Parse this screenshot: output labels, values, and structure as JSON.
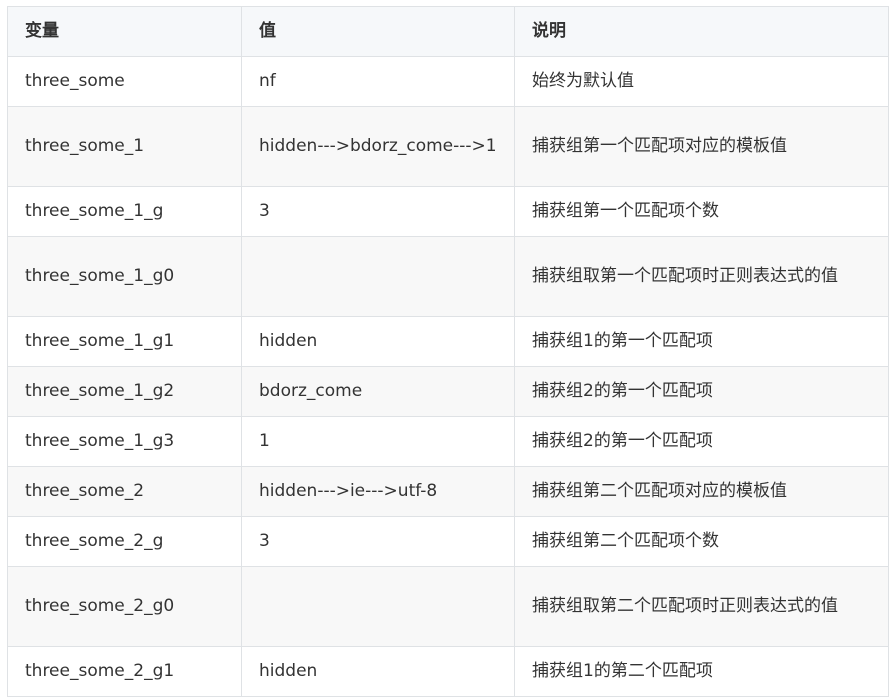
{
  "table": {
    "headers": [
      "变量",
      "值",
      "说明"
    ],
    "rows": [
      {
        "var": "three_some",
        "value": "nf",
        "desc": "始终为默认值"
      },
      {
        "var": "three_some_1",
        "value": "hidden--->bdorz_come--->1",
        "desc": "捕获组第一个匹配项对应的模板值"
      },
      {
        "var": "three_some_1_g",
        "value": "3",
        "desc": "捕获组第一个匹配项个数"
      },
      {
        "var": "three_some_1_g0",
        "value": "",
        "desc": "捕获组取第一个匹配项时正则表达式的值"
      },
      {
        "var": "three_some_1_g1",
        "value": "hidden",
        "desc": "捕获组1的第一个匹配项"
      },
      {
        "var": "three_some_1_g2",
        "value": "bdorz_come",
        "desc": "捕获组2的第一个匹配项"
      },
      {
        "var": "three_some_1_g3",
        "value": "1",
        "desc": "捕获组2的第一个匹配项"
      },
      {
        "var": "three_some_2",
        "value": "hidden--->ie--->utf-8",
        "desc": "捕获组第二个匹配项对应的模板值"
      },
      {
        "var": "three_some_2_g",
        "value": "3",
        "desc": "捕获组第二个匹配项个数"
      },
      {
        "var": "three_some_2_g0",
        "value": "",
        "desc": "捕获组取第二个匹配项时正则表达式的值"
      },
      {
        "var": "three_some_2_g1",
        "value": "hidden",
        "desc": "捕获组1的第二个匹配项"
      }
    ]
  }
}
